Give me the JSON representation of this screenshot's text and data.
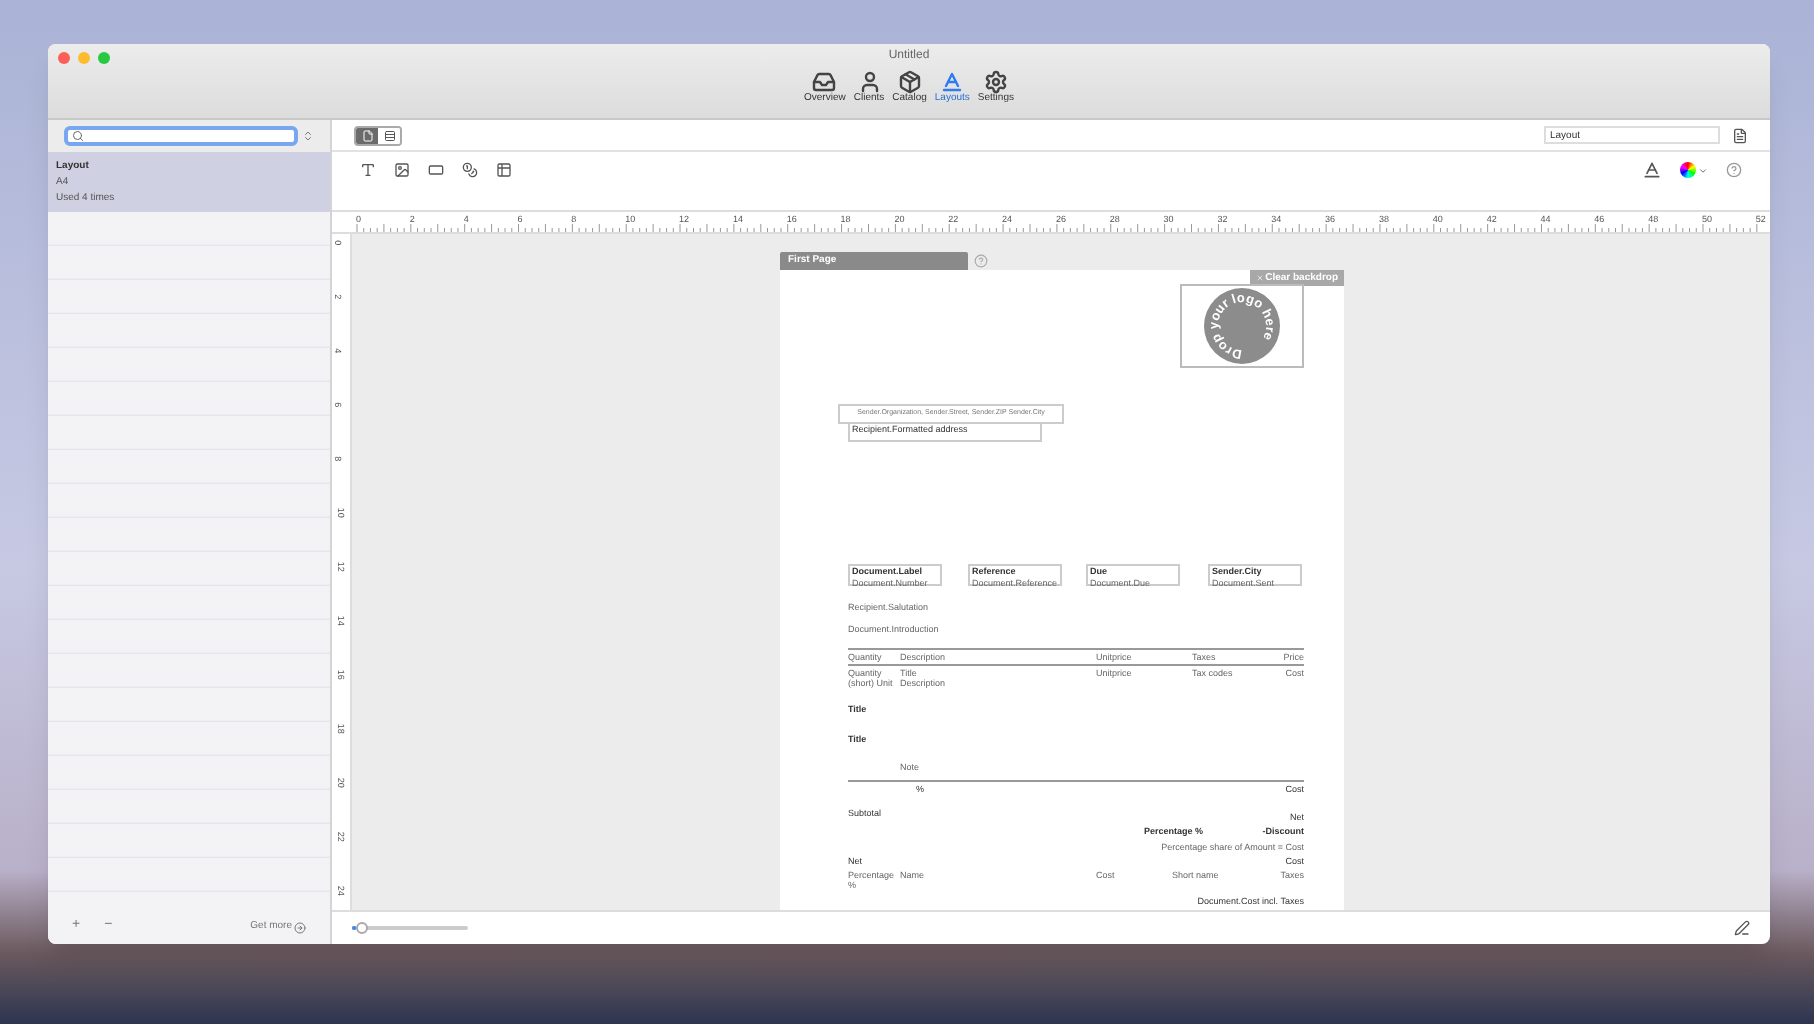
{
  "window": {
    "title": "Untitled"
  },
  "toolbar": [
    {
      "kind": "overview",
      "label": "Overview",
      "selected": false
    },
    {
      "kind": "clients",
      "label": "Clients",
      "selected": false
    },
    {
      "kind": "catalog",
      "label": "Catalog",
      "selected": false
    },
    {
      "kind": "layouts",
      "label": "Layouts",
      "selected": true
    },
    {
      "kind": "settings",
      "label": "Settings",
      "selected": false
    }
  ],
  "sidebar": {
    "items": [
      {
        "title": "Layout",
        "subtitle": "A4",
        "usage": "Used 4 times",
        "selected": true
      }
    ],
    "footer": {
      "add": "+",
      "remove": "−",
      "get_more": "Get more"
    }
  },
  "view_modes": [
    {
      "kind": "page",
      "selected": true
    },
    {
      "kind": "list",
      "selected": false
    }
  ],
  "layout_name": {
    "value": "Layout"
  },
  "tools": [
    {
      "kind": "text"
    },
    {
      "kind": "image"
    },
    {
      "kind": "box"
    },
    {
      "kind": "currency"
    },
    {
      "kind": "table"
    }
  ],
  "ruler": {
    "horizontal": [
      "0",
      "2",
      "4",
      "6",
      "8",
      "10",
      "12",
      "14",
      "16",
      "18",
      "20",
      "22",
      "24",
      "26",
      "28",
      "30",
      "32",
      "34",
      "36",
      "38",
      "40",
      "42",
      "44",
      "46",
      "48",
      "50",
      "52"
    ],
    "vertical": [
      "0",
      "2",
      "4",
      "6",
      "8",
      "10",
      "12",
      "14",
      "16",
      "18",
      "20",
      "22",
      "24"
    ]
  },
  "page": {
    "tab": "First Page",
    "clear_backdrop": "Clear backdrop",
    "logo_text": "Drop your logo here",
    "sender_line": "Sender.Organization, Sender.Street, Sender.ZIP Sender.City",
    "recipient": "Recipient.Formatted address",
    "info_boxes": [
      {
        "label": "Document.Label",
        "value": "Document.Number"
      },
      {
        "label": "Reference",
        "value": "Document.Reference"
      },
      {
        "label": "Due",
        "value": "Document.Due"
      },
      {
        "label": "Sender.City",
        "value": "Document.Sent"
      }
    ],
    "salutation": "Recipient.Salutation",
    "introduction": "Document.Introduction",
    "items_header": [
      "Quantity",
      "Description",
      "Unitprice",
      "Taxes",
      "Price"
    ],
    "item_row": [
      "Quantity (short) Unit",
      "Title Description",
      "Unitprice",
      "Tax codes",
      "Cost"
    ],
    "titles": [
      "Title",
      "Title"
    ],
    "note": "Note",
    "note_percent": "%",
    "note_cost": "Cost",
    "subtotal": "Subtotal",
    "subtotal_net": "Net",
    "discount_label": "Percentage %",
    "discount_value": "-Discount",
    "share": "Percentage share of Amount = Cost",
    "net": "Net",
    "net_cost": "Cost",
    "tax_row": [
      "Percentage %",
      "Name",
      "Cost",
      "Short name",
      "Taxes"
    ],
    "total": "Document.Cost incl. Taxes"
  },
  "zoom": {
    "level": 0.08
  }
}
